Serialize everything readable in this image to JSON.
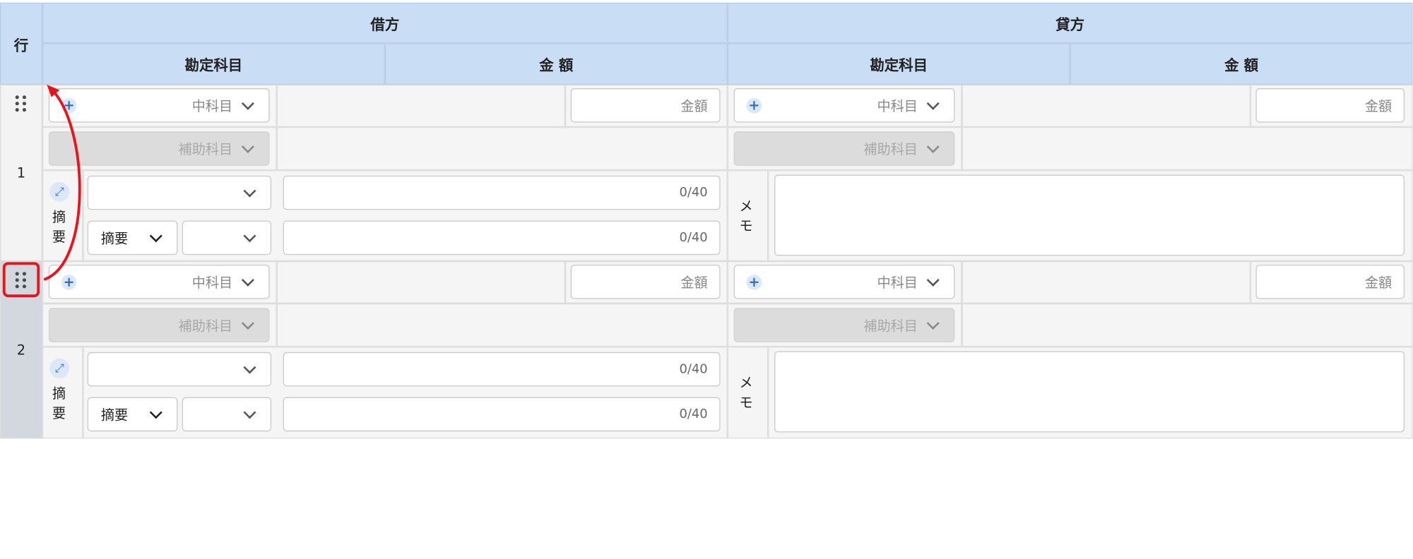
{
  "header": {
    "row_label": "行",
    "debit_label": "借方",
    "credit_label": "貸方",
    "account_label": "勘定科目",
    "amount_label": "金 額"
  },
  "rows": [
    {
      "number": "1",
      "debit": {
        "mid_account_placeholder": "中科目",
        "sub_account_placeholder": "補助科目",
        "amount_placeholder": "金額"
      },
      "credit": {
        "mid_account_placeholder": "中科目",
        "sub_account_placeholder": "補助科目",
        "amount_placeholder": "金額"
      },
      "summary_label_1": "摘",
      "summary_label_2": "要",
      "summary_select": "摘要",
      "summary_count_1": "0/40",
      "summary_count_2": "0/40",
      "memo_label_1": "メ",
      "memo_label_2": "モ"
    },
    {
      "number": "2",
      "debit": {
        "mid_account_placeholder": "中科目",
        "sub_account_placeholder": "補助科目",
        "amount_placeholder": "金額"
      },
      "credit": {
        "mid_account_placeholder": "中科目",
        "sub_account_placeholder": "補助科目",
        "amount_placeholder": "金額"
      },
      "summary_label_1": "摘",
      "summary_label_2": "要",
      "summary_select": "摘要",
      "summary_count_1": "0/40",
      "summary_count_2": "0/40",
      "memo_label_1": "メ",
      "memo_label_2": "モ"
    }
  ],
  "colors": {
    "header_bg": "#c9ddf5",
    "accent_blue": "#2f6fc0",
    "highlight_red": "#e8141c",
    "selected_row_bg": "#d3d7de"
  },
  "icons": [
    "drag-handle-icon",
    "plus-icon",
    "chevron-down-icon",
    "expand-icon",
    "drag-arrow-annotation"
  ]
}
